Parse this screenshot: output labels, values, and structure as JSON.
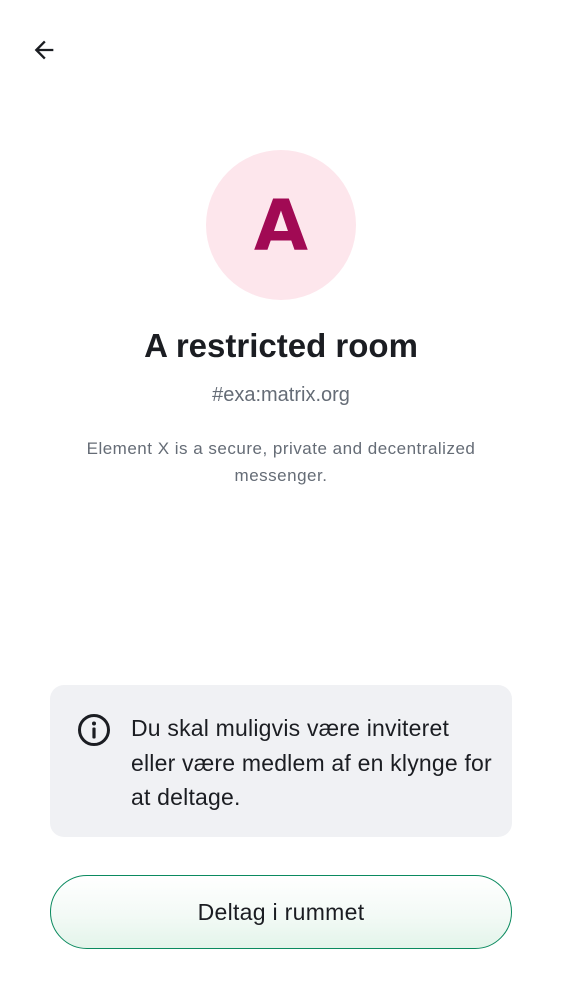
{
  "header": {
    "back_icon": "arrow-left-icon"
  },
  "room": {
    "avatar_letter": "A",
    "avatar_bg_color": "#fde6ec",
    "avatar_letter_color": "#a10a54",
    "name": "A restricted room",
    "alias": "#exa:matrix.org",
    "topic": "Element X is a secure, private and decentralized messenger."
  },
  "notice": {
    "icon": "info-icon",
    "text": "Du skal muligvis være inviteret eller være medlem af en klynge for at deltage."
  },
  "actions": {
    "join_label": "Deltag i rummet",
    "accent_color": "#0b8a5f"
  }
}
